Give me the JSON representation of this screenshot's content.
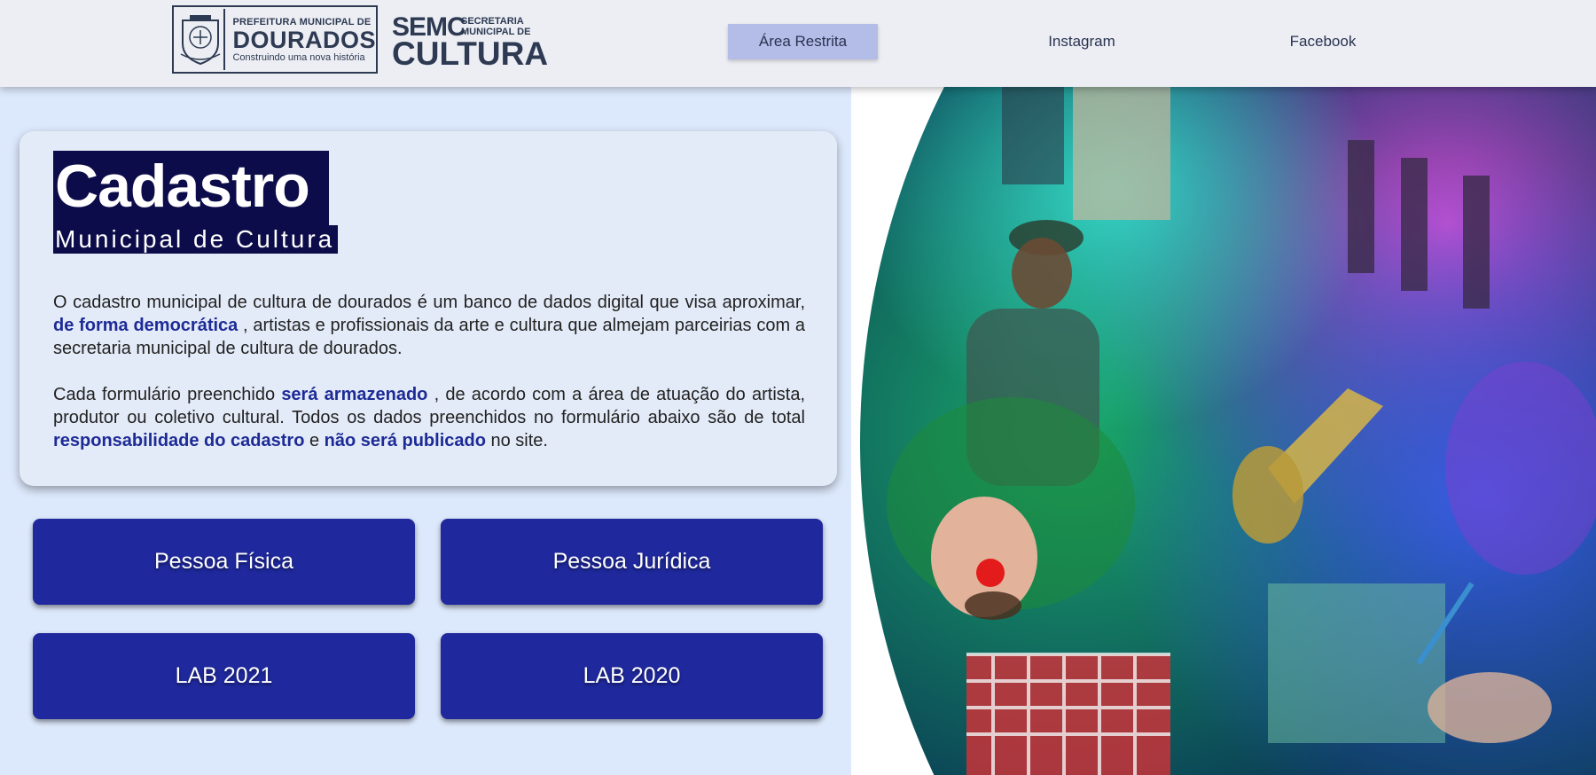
{
  "header": {
    "pref_logo": {
      "top": "PREFEITURA MUNICIPAL DE",
      "main": "DOURADOS",
      "sub": "Construindo uma nova história"
    },
    "semc_logo": {
      "acronym": "SEMC",
      "line1": "SECRETARIA",
      "line2": "MUNICIPAL DE",
      "word": "CULTURA"
    },
    "nav": {
      "area_restrita": "Área Restrita",
      "instagram": "Instagram",
      "facebook": "Facebook"
    }
  },
  "card": {
    "title": "Cadastro",
    "subtitle": "Municipal de Cultura",
    "p1": {
      "a": "O cadastro municipal de cultura de dourados é um banco de dados digital que visa aproximar, ",
      "h1": "de forma democrática",
      "b": " , artistas e profissionais da arte e cultura que almejam parceirias com a secretaria municipal de cultura de dourados."
    },
    "p2": {
      "a": "Cada formulário preenchido ",
      "h1": "será armazenado",
      "b": " , de acordo com a área de atuação do artista, produtor ou coletivo cultural. Todos os dados preenchidos no formulário abaixo são de total ",
      "h2": "responsabilidade do cadastro",
      "c": " e ",
      "h3": "não será publicado",
      "d": " no site."
    }
  },
  "buttons": {
    "pessoa_fisica": "Pessoa Física",
    "pessoa_juridica": "Pessoa Jurídica",
    "lab2021": "LAB 2021",
    "lab2020": "LAB 2020"
  },
  "colors": {
    "header_bg": "#eceef4",
    "page_bg": "#dce8fb",
    "button_bg": "#1f299d",
    "highlight": "#1d2b97",
    "title_bg": "#0d0c4a",
    "nav_active": "#b3bde8"
  }
}
